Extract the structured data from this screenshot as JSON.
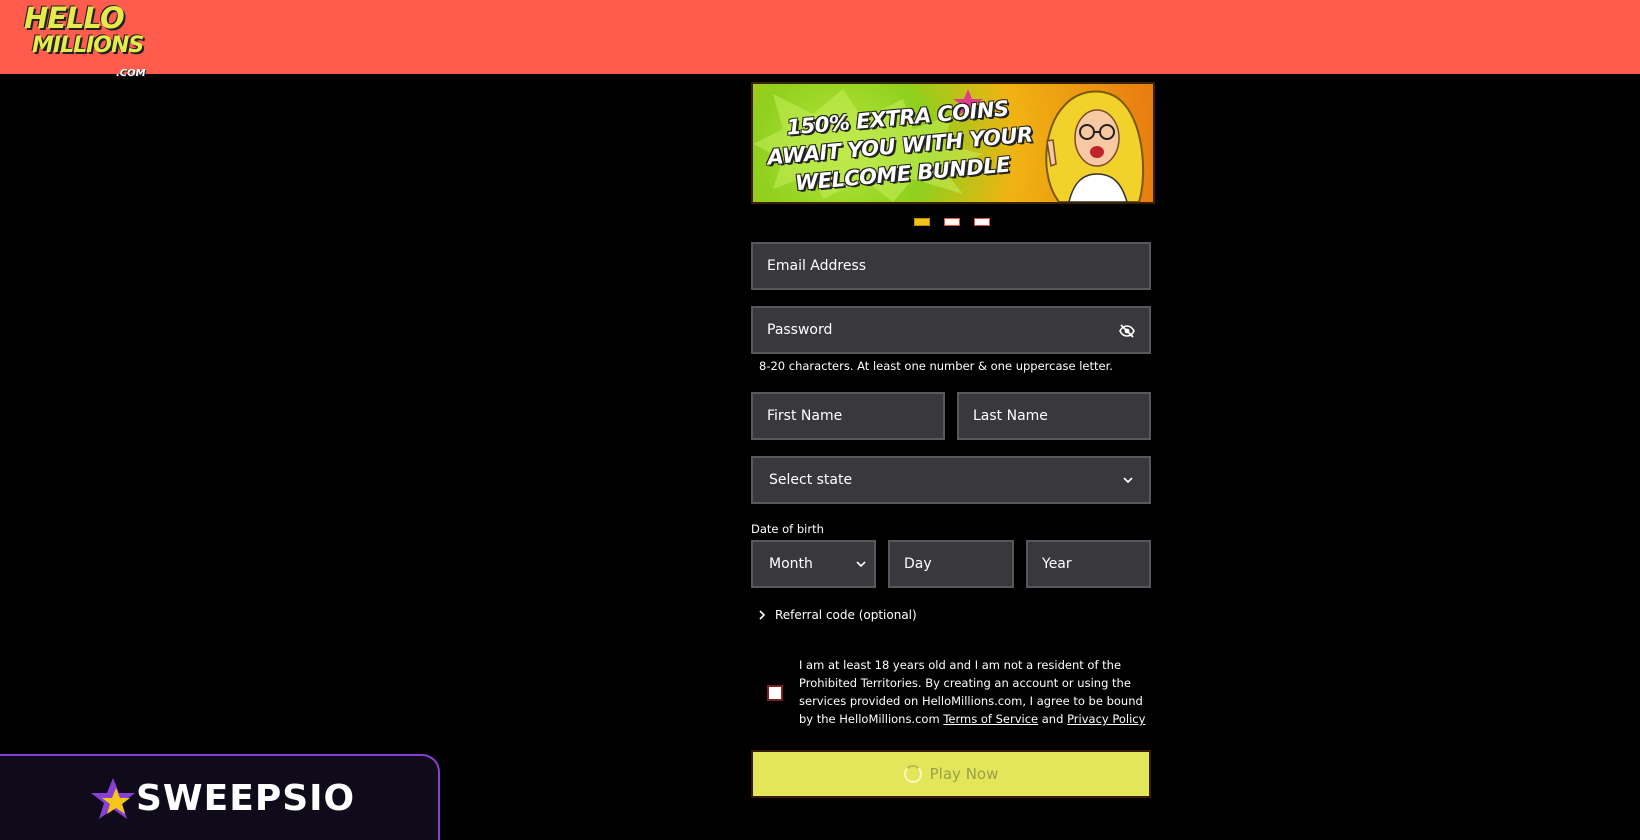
{
  "header": {
    "logo": {
      "line1": "HELLO",
      "line2": "MILLIONS",
      "line3": ".COM"
    },
    "bg_color": "#ff5c4d"
  },
  "banner": {
    "headline": "150% EXTRA COINS AWAIT YOU WITH YOUR WELCOME BUNDLE",
    "slides": 3,
    "active_slide": 0
  },
  "form": {
    "email": {
      "placeholder": "Email Address"
    },
    "password": {
      "placeholder": "Password",
      "toggle_icon": "eye-off-icon"
    },
    "password_helper": "8-20 characters. At least one number & one uppercase letter.",
    "first_name": {
      "placeholder": "First Name"
    },
    "last_name": {
      "placeholder": "Last Name"
    },
    "state": {
      "selected": "Select state"
    },
    "dob": {
      "label": "Date of birth",
      "month": "Month",
      "day": "Day",
      "year": "Year"
    },
    "referral": "Referral code (optional)",
    "terms": {
      "text_before": "I am at least 18 years old and I am not a resident of the Prohibited Territories. By creating an account or using the services provided on HelloMillions.com, I agree to be bound by the HelloMillions.com ",
      "tos_link": "Terms of Service",
      "and": " and ",
      "privacy_link": "Privacy Policy",
      "checked": false
    },
    "submit_label": "Play Now"
  },
  "sweepsio": {
    "label": "SWEEPSIO",
    "border_color": "#8a3fd4"
  },
  "colors": {
    "field_bg": "#39383c",
    "button_bg": "#e4e65a",
    "dot_active": "#f0c21b"
  }
}
